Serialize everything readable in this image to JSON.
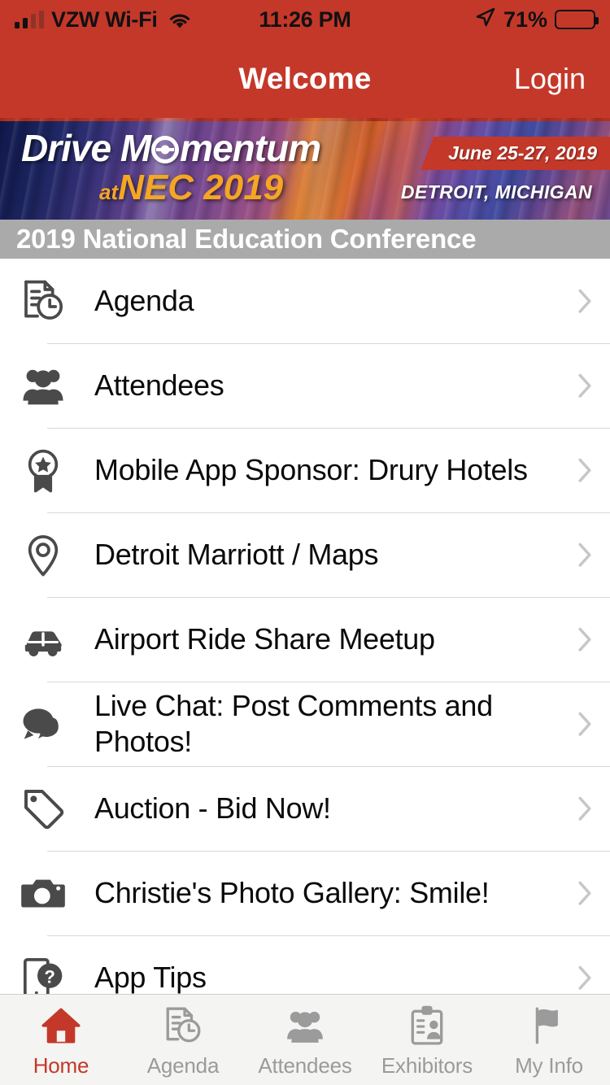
{
  "status_bar": {
    "carrier": "VZW Wi-Fi",
    "wifi_icon": "wifi-icon",
    "signal_icon": "signal-bars-icon",
    "time": "11:26 PM",
    "location_icon": "location-arrow-icon",
    "battery_percent": "71%",
    "battery_level": 71,
    "battery_icon": "battery-icon"
  },
  "nav_bar": {
    "title": "Welcome",
    "login_label": "Login"
  },
  "banner": {
    "logo_line1_prefix": "Drive M",
    "logo_line1_suffix": "mentum",
    "wheel_icon": "steering-wheel-icon",
    "logo_at": "at",
    "logo_line2": "NEC 2019",
    "dates": "June 25-27, 2019",
    "city": "DETROIT, MICHIGAN",
    "accent_color": "#C4382A",
    "gold_color": "#F5A623"
  },
  "subtitle": {
    "text": "2019 National Education Conference",
    "background_color": "#AAAAAA"
  },
  "menu": {
    "items": [
      {
        "label": "Agenda",
        "icon": "document-clock-icon"
      },
      {
        "label": "Attendees",
        "icon": "people-group-icon"
      },
      {
        "label": "Mobile App Sponsor: Drury Hotels",
        "icon": "award-ribbon-icon"
      },
      {
        "label": "Detroit Marriott / Maps",
        "icon": "map-pin-icon"
      },
      {
        "label": "Airport Ride Share Meetup",
        "icon": "car-icon"
      },
      {
        "label": "Live Chat: Post Comments and Photos!",
        "icon": "chat-bubbles-icon"
      },
      {
        "label": "Auction - Bid Now!",
        "icon": "tag-icon"
      },
      {
        "label": "Christie's Photo Gallery: Smile!",
        "icon": "camera-icon"
      },
      {
        "label": "App Tips",
        "icon": "phone-help-icon"
      }
    ],
    "chevron_icon": "chevron-right-icon"
  },
  "tab_bar": {
    "active_color": "#C4382A",
    "inactive_color": "#9B9B9B",
    "tabs": [
      {
        "label": "Home",
        "icon": "home-icon",
        "active": true
      },
      {
        "label": "Agenda",
        "icon": "document-clock-icon",
        "active": false
      },
      {
        "label": "Attendees",
        "icon": "people-group-icon",
        "active": false
      },
      {
        "label": "Exhibitors",
        "icon": "clipboard-person-icon",
        "active": false
      },
      {
        "label": "My Info",
        "icon": "flag-icon",
        "active": false
      }
    ]
  }
}
